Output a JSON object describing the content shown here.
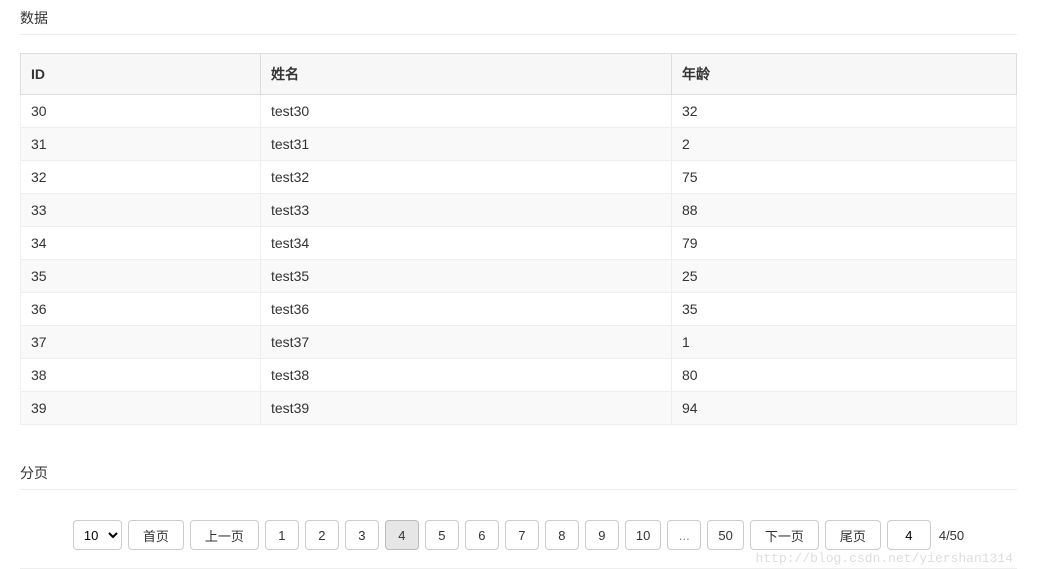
{
  "sections": {
    "data_title": "数据",
    "pager_title": "分页"
  },
  "table": {
    "headers": {
      "id": "ID",
      "name": "姓名",
      "age": "年龄"
    },
    "rows": [
      {
        "id": "30",
        "name": "test30",
        "age": "32"
      },
      {
        "id": "31",
        "name": "test31",
        "age": "2"
      },
      {
        "id": "32",
        "name": "test32",
        "age": "75"
      },
      {
        "id": "33",
        "name": "test33",
        "age": "88"
      },
      {
        "id": "34",
        "name": "test34",
        "age": "79"
      },
      {
        "id": "35",
        "name": "test35",
        "age": "25"
      },
      {
        "id": "36",
        "name": "test36",
        "age": "35"
      },
      {
        "id": "37",
        "name": "test37",
        "age": "1"
      },
      {
        "id": "38",
        "name": "test38",
        "age": "80"
      },
      {
        "id": "39",
        "name": "test39",
        "age": "94"
      }
    ]
  },
  "pager": {
    "page_size_selected": "10",
    "first": "首页",
    "prev": "上一页",
    "next": "下一页",
    "last": "尾页",
    "pages_left": [
      "1",
      "2",
      "3",
      "4",
      "5",
      "6",
      "7",
      "8",
      "9",
      "10"
    ],
    "ellipsis": "...",
    "pages_right": [
      "50"
    ],
    "current_page": "4",
    "goto_value": "4",
    "total_label": "4/50"
  },
  "watermark": "http://blog.csdn.net/yiershan1314"
}
